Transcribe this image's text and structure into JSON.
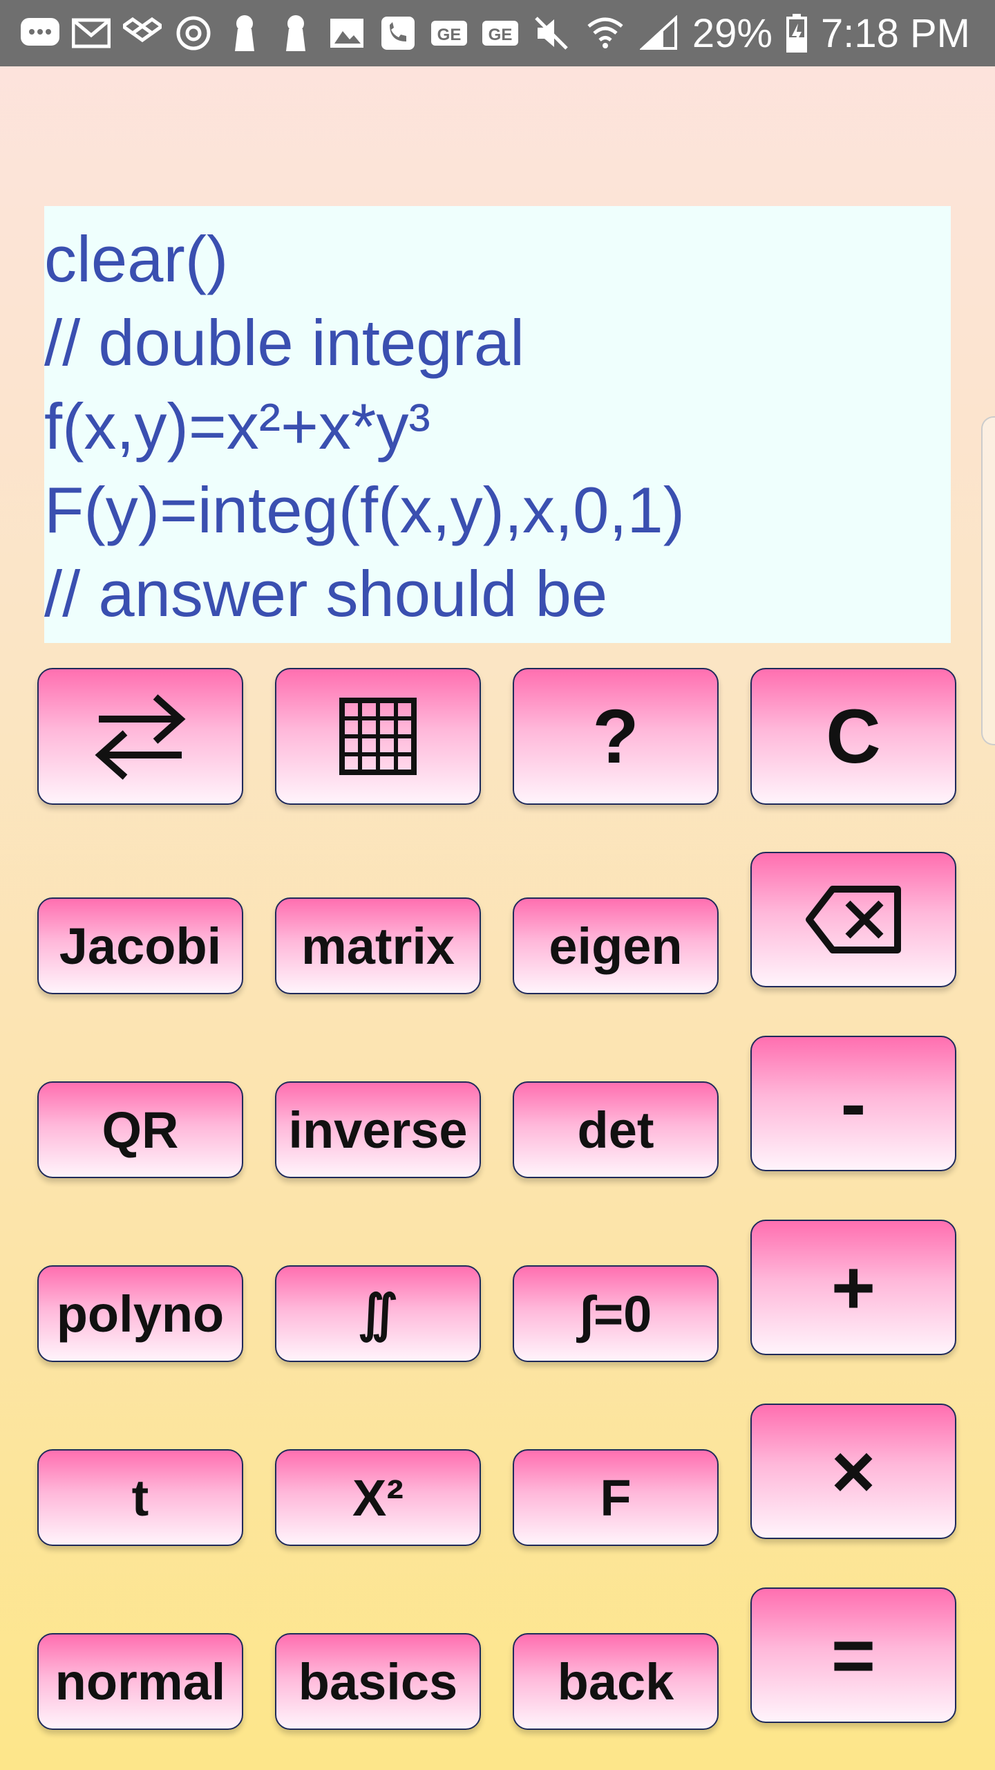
{
  "status_bar": {
    "left_icons": [
      "messages-icon",
      "gmail-icon",
      "dropbox-icon",
      "chrome-icon",
      "keyhole-icon",
      "keyhole-icon",
      "gallery-icon",
      "call-icon",
      "ge-icon",
      "ge-icon"
    ],
    "battery": "29%",
    "time": "7:18 PM",
    "right_icons": [
      "mute-icon",
      "wifi-icon",
      "signal-icon",
      "battery-icon"
    ]
  },
  "editor": {
    "lines": [
      "clear()",
      "// double integral",
      "f(x,y)=x²+x*y³",
      "F(y)=integ(f(x,y),x,0,1)",
      "// answer should be"
    ]
  },
  "keypad": {
    "row1": {
      "swap_icon": "swap-arrows-icon",
      "grid_icon": "grid-icon",
      "help": "?",
      "clear": "C"
    },
    "row2": {
      "jacobi": "Jacobi",
      "matrix": "matrix",
      "eigen": "eigen",
      "backspace_icon": "backspace-icon"
    },
    "row3": {
      "qr": "QR",
      "inverse": "inverse",
      "det": "det",
      "minus": "-"
    },
    "row4": {
      "polyno": "polyno",
      "double_integral": "∬",
      "integral_zero": "∫=0",
      "plus": "+"
    },
    "row5": {
      "t": "t",
      "x_squared": "X²",
      "f": "F",
      "times": "×"
    },
    "row6": {
      "normal": "normal",
      "basics": "basics",
      "back": "back",
      "equals": "="
    }
  },
  "colors": {
    "button_top": "#ff6fb0",
    "button_bottom": "#fff4fb",
    "editor_bg": "#effffd",
    "editor_text": "#3a4fb0",
    "status_bar": "#6f6f6f"
  }
}
